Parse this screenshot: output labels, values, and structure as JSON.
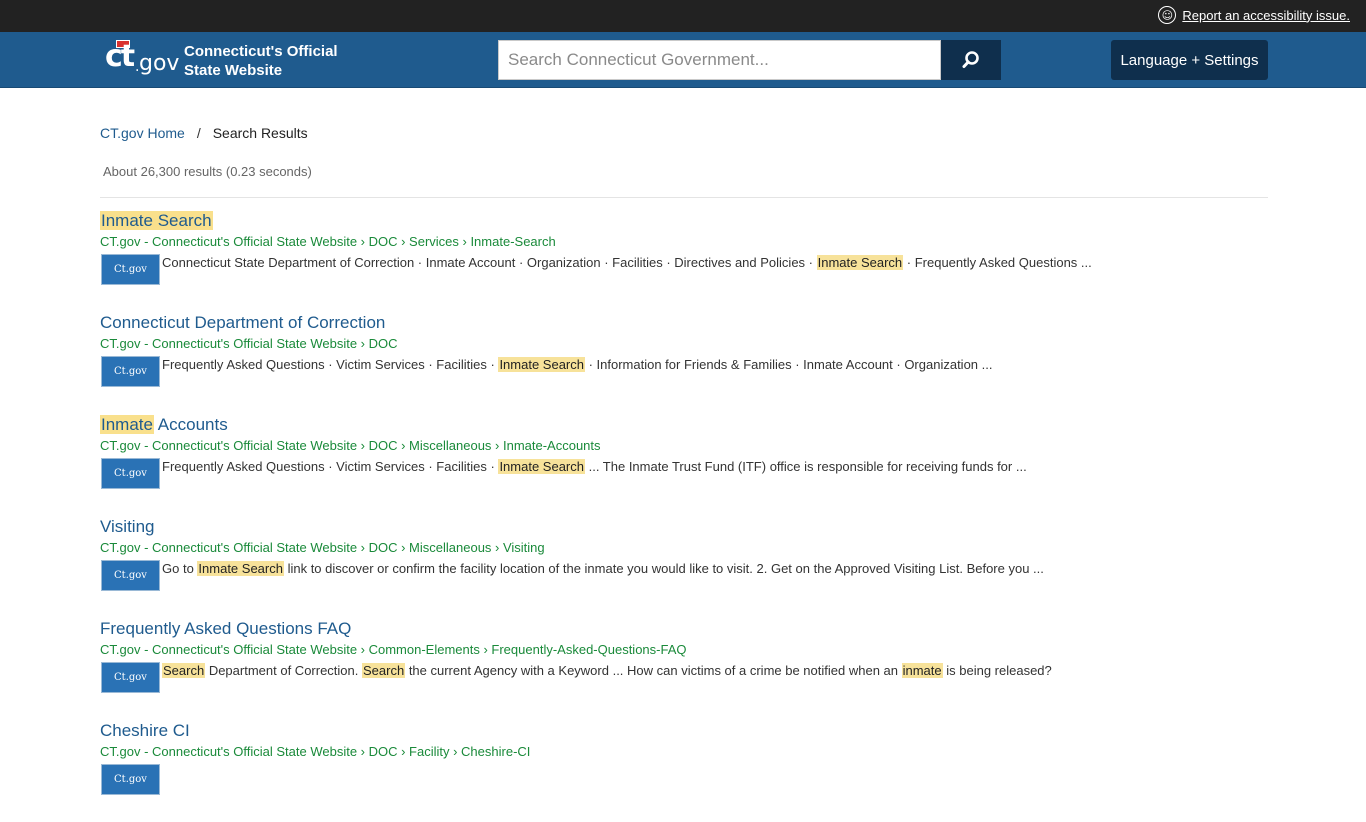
{
  "topbar": {
    "accessibility_link": "Report an accessibility issue."
  },
  "header": {
    "logo_text": "ct",
    "logo_gov": "gov",
    "site_title_line1": "Connecticut's Official",
    "site_title_line2": "State Website",
    "search_placeholder": "Search Connecticut Government...",
    "language_button": "Language + Settings"
  },
  "breadcrumb": {
    "home": "CT.gov Home",
    "separator": "/",
    "current": "Search Results"
  },
  "results_count": "About 26,300 results (0.23 seconds)",
  "colors": {
    "header": "#1f5b8e",
    "topbar": "#222222",
    "dark_button": "#0f2f4d",
    "link": "#1f5b8e",
    "url": "#1a8a3a",
    "highlight": "#f7e29a"
  },
  "results": [
    {
      "title": [
        {
          "text": "Inmate Search",
          "hl": true
        }
      ],
      "url": "CT.gov - Connecticut's Official State Website › DOC › Services › Inmate-Search",
      "thumb": "Ct.gov",
      "snippet": [
        {
          "text": "Connecticut State Department of Correction · Inmate Account · Organization · Facilities · Directives and Policies · ",
          "hl": false
        },
        {
          "text": "Inmate Search",
          "hl": true
        },
        {
          "text": " · Frequently Asked Questions ...",
          "hl": false
        }
      ]
    },
    {
      "title": [
        {
          "text": "Connecticut Department of Correction",
          "hl": false
        }
      ],
      "url": "CT.gov - Connecticut's Official State Website › DOC",
      "thumb": "Ct.gov",
      "snippet": [
        {
          "text": "Frequently Asked Questions · Victim Services · Facilities · ",
          "hl": false
        },
        {
          "text": "Inmate Search",
          "hl": true
        },
        {
          "text": " · Information for Friends & Families · Inmate Account · Organization ...",
          "hl": false
        }
      ]
    },
    {
      "title": [
        {
          "text": "Inmate",
          "hl": true
        },
        {
          "text": " Accounts",
          "hl": false
        }
      ],
      "url": "CT.gov - Connecticut's Official State Website › DOC › Miscellaneous › Inmate-Accounts",
      "thumb": "Ct.gov",
      "snippet": [
        {
          "text": "Frequently Asked Questions · Victim Services · Facilities · ",
          "hl": false
        },
        {
          "text": "Inmate Search",
          "hl": true
        },
        {
          "text": " ... The Inmate Trust Fund (ITF) office is responsible for receiving funds for ...",
          "hl": false
        }
      ]
    },
    {
      "title": [
        {
          "text": "Visiting",
          "hl": false
        }
      ],
      "url": "CT.gov - Connecticut's Official State Website › DOC › Miscellaneous › Visiting",
      "thumb": "Ct.gov",
      "snippet": [
        {
          "text": "Go to ",
          "hl": false
        },
        {
          "text": "Inmate Search",
          "hl": true
        },
        {
          "text": " link to discover or confirm the facility location of the inmate you would like to visit. 2. Get on the Approved Visiting List. Before you ...",
          "hl": false
        }
      ]
    },
    {
      "title": [
        {
          "text": "Frequently Asked Questions FAQ",
          "hl": false
        }
      ],
      "url": "CT.gov - Connecticut's Official State Website › Common-Elements › Frequently-Asked-Questions-FAQ",
      "thumb": "Ct.gov",
      "snippet": [
        {
          "text": "Search",
          "hl": true
        },
        {
          "text": " Department of Correction. ",
          "hl": false
        },
        {
          "text": "Search",
          "hl": true
        },
        {
          "text": " the current Agency with a Keyword ... How can victims of a crime be notified when an ",
          "hl": false
        },
        {
          "text": "inmate",
          "hl": true
        },
        {
          "text": " is being released?",
          "hl": false
        }
      ]
    },
    {
      "title": [
        {
          "text": "Cheshire CI",
          "hl": false
        }
      ],
      "url": "CT.gov - Connecticut's Official State Website › DOC › Facility › Cheshire-CI",
      "thumb": "Ct.gov",
      "snippet": []
    }
  ]
}
